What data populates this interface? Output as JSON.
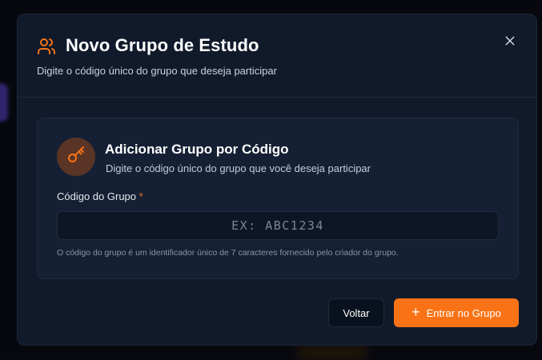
{
  "modal": {
    "title": "Novo Grupo de Estudo",
    "subtitle": "Digite o código único do grupo que deseja participar",
    "close_icon": "close-icon",
    "title_icon": "users-icon"
  },
  "card": {
    "icon": "key-icon",
    "title": "Adicionar Grupo por Código",
    "description": "Digite o código único do grupo que você deseja participar",
    "field_label": "Código do Grupo",
    "required_marker": "*",
    "input_value": "",
    "input_placeholder": "EX: ABC1234",
    "hint": "O código do grupo é um identificador único de 7 caracteres fornecido pelo criador do grupo."
  },
  "actions": {
    "back_label": "Voltar",
    "enter_label": "Entrar no Grupo",
    "enter_icon": "plus-icon"
  },
  "colors": {
    "accent": "#f97316",
    "modal_bg": "#111a2b",
    "card_bg": "#152034"
  }
}
